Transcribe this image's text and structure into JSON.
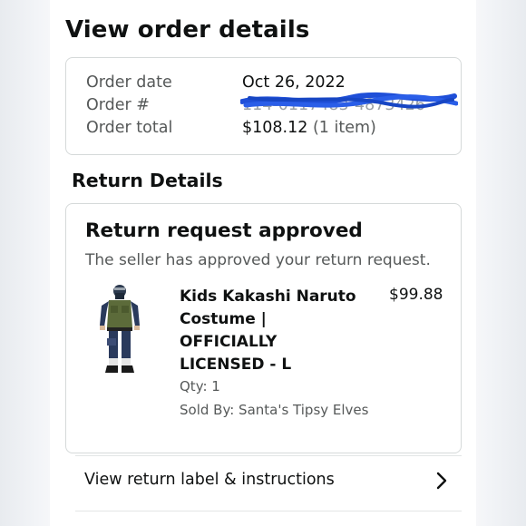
{
  "page": {
    "title": "View order details"
  },
  "order_summary": {
    "date_label": "Order date",
    "date_value": "Oct 26, 2022",
    "number_label": "Order #",
    "number_value": "114-0117483-4873426",
    "total_label": "Order total",
    "total_value": "$108.12",
    "total_items": "(1 item)"
  },
  "return_details": {
    "heading": "Return Details",
    "status_title": "Return request approved",
    "status_message": "The seller has approved your return request.",
    "item": {
      "name": "Kids Kakashi Naruto Costume | OFFICIALLY LICENSED - L",
      "price": "$99.88",
      "qty": "Qty: 1",
      "seller": "Sold By: Santa's Tipsy Elves"
    }
  },
  "actions": {
    "return_label_link": "View return label & instructions"
  },
  "colors": {
    "text_primary": "#0f1111",
    "text_secondary": "#565959",
    "border": "#d5d9d9",
    "redaction": "#1f4fd8"
  },
  "icons": {
    "chevron": "chevron-right-icon"
  }
}
